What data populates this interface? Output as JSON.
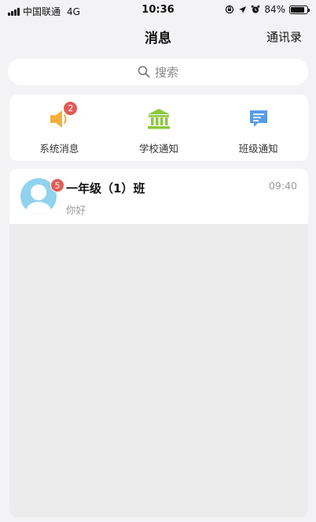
{
  "status_bar": {
    "carrier": "中国联通",
    "network": "4G",
    "time": "10:36",
    "battery_text": "84%",
    "battery_level": 0.84
  },
  "nav": {
    "title": "消息",
    "contacts_label": "通讯录"
  },
  "search": {
    "placeholder": "搜索"
  },
  "quick_actions": [
    {
      "label": "系统消息",
      "icon": "speaker-icon",
      "badge": "2",
      "color": "#f4b03e"
    },
    {
      "label": "学校通知",
      "icon": "school-building-icon",
      "badge": "",
      "color": "#8cc63f"
    },
    {
      "label": "班级通知",
      "icon": "chat-bubble-icon",
      "badge": "",
      "color": "#5a9be8"
    }
  ],
  "chats": [
    {
      "name": "一年级（1）班",
      "last_message": "你好",
      "time": "09:40",
      "unread": "5"
    }
  ],
  "colors": {
    "background": "#f3f3f5",
    "badge": "#e25a56",
    "avatar": "#8fd3ef"
  }
}
